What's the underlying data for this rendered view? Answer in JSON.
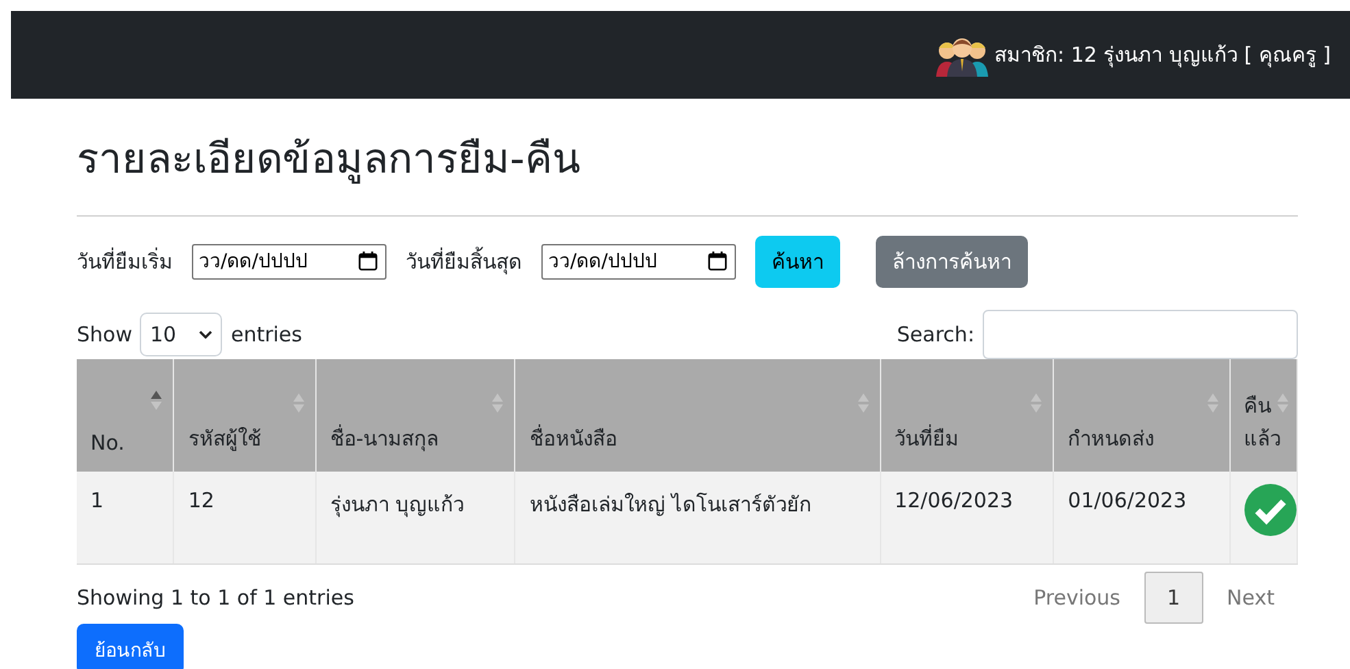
{
  "navbar": {
    "user_label": "สมาชิก: 12 รุ่งนภา บุญแก้ว [ คุณครู ]"
  },
  "title": "รายละเอียดข้อมูลการยืม-คืน",
  "filters": [
    {
      "label": "วันที่ยืมเริ่ม",
      "placeholder": "วว/ดด/ปปปป"
    },
    {
      "label": "วันที่ยืมสิ้นสุด",
      "placeholder": "วว/ดด/ปปปป"
    }
  ],
  "buttons": [
    {
      "kind": "search",
      "label": "ค้นหา"
    },
    {
      "kind": "clear",
      "label": "ล้างการค้นหา"
    }
  ],
  "length": {
    "before": "Show",
    "value": "10",
    "after": "entries"
  },
  "search": {
    "label": "Search:"
  },
  "table": {
    "columns": [
      {
        "label": "No.",
        "sorted": true
      },
      {
        "label": "รหัสผู้ใช้",
        "sorted": false
      },
      {
        "label": "ชื่อ-นามสกุล",
        "sorted": false
      },
      {
        "label": "ชื่อหนังสือ",
        "sorted": false
      },
      {
        "label": "วันที่ยืม",
        "sorted": false
      },
      {
        "label": "กำหนดส่ง",
        "sorted": false
      },
      {
        "label": "คืนแล้ว",
        "sorted": false
      }
    ],
    "rows": [
      {
        "cells": [
          "1",
          "12",
          "รุ่งนภา บุญแก้ว",
          "หนังสือเล่มใหญ่ ไดโนเสาร์ตัวยัก",
          "12/06/2023",
          "01/06/2023"
        ],
        "returned": true
      }
    ]
  },
  "info": "Showing 1 to 1 of 1 entries",
  "pagination": [
    {
      "label": "Previous",
      "disabled": true,
      "selected": false
    },
    {
      "label": "1",
      "disabled": false,
      "selected": true
    },
    {
      "label": "Next",
      "disabled": true,
      "selected": false
    }
  ],
  "back_button": "ย้อนกลับ"
}
